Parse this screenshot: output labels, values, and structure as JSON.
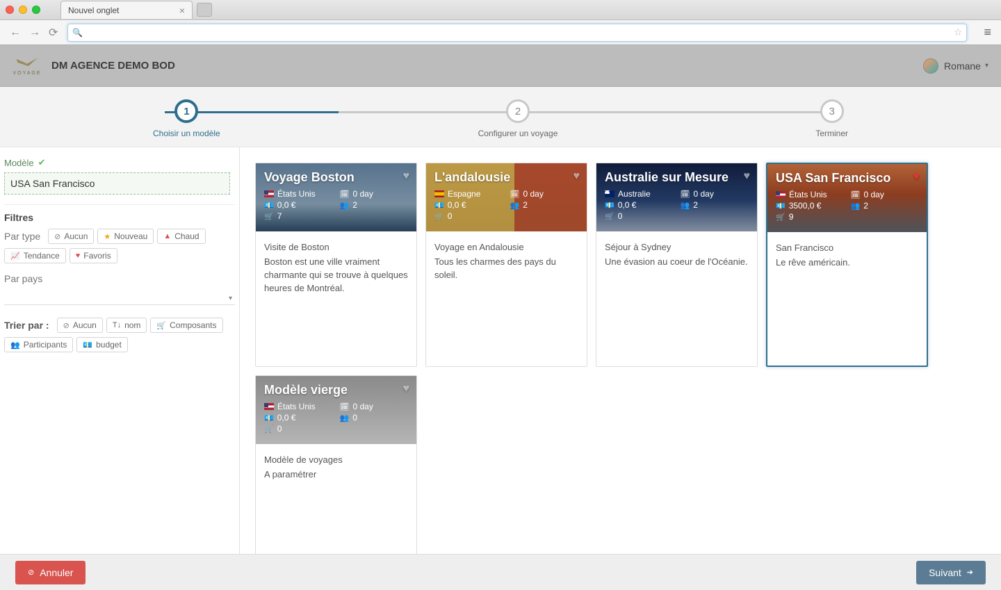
{
  "browser": {
    "tab_title": "Nouvel onglet",
    "url": ""
  },
  "header": {
    "agency": "DM AGENCE DEMO BOD",
    "logo_text": "VOYAGE",
    "user_name": "Romane"
  },
  "stepper": {
    "steps": [
      {
        "num": "1",
        "label": "Choisir un modèle"
      },
      {
        "num": "2",
        "label": "Configurer un voyage"
      },
      {
        "num": "3",
        "label": "Terminer"
      }
    ]
  },
  "sidebar": {
    "model_label": "Modèle",
    "model_value": "USA San Francisco",
    "filters_title": "Filtres",
    "type_label": "Par type",
    "type_chips": {
      "none": "Aucun",
      "new": "Nouveau",
      "hot": "Chaud",
      "trend": "Tendance",
      "fav": "Favoris"
    },
    "country_label": "Par pays",
    "sort_label": "Trier par :",
    "sort_chips": {
      "none": "Aucun",
      "name": "nom",
      "components": "Composants",
      "participants": "Participants",
      "budget": "budget"
    }
  },
  "cards": [
    {
      "title": "Voyage Boston",
      "country": "États Unis",
      "flag": "us",
      "days": "0 day",
      "price": "0,0 €",
      "people": "2",
      "cart": "7",
      "fav": false,
      "lead": "Visite de Boston",
      "desc": "Boston est une ville vraiment charmante qui se trouve à quelques heures de Montréal.",
      "bg": "ch-boston",
      "selected": false
    },
    {
      "title": "L'andalousie",
      "country": "Espagne",
      "flag": "es",
      "days": "0 day",
      "price": "0,0 €",
      "people": "2",
      "cart": "0",
      "fav": false,
      "lead": "Voyage en Andalousie",
      "desc": "Tous les charmes des pays du soleil.",
      "bg": "ch-andal",
      "selected": false
    },
    {
      "title": "Australie sur Mesure",
      "country": "Australie",
      "flag": "au",
      "days": "0 day",
      "price": "0,0 €",
      "people": "2",
      "cart": "0",
      "fav": false,
      "lead": "Séjour à Sydney",
      "desc": "Une évasion au coeur de l'Océanie.",
      "bg": "ch-austr",
      "selected": false
    },
    {
      "title": "USA San Francisco",
      "country": "États Unis",
      "flag": "us",
      "days": "0 day",
      "price": "3500,0 €",
      "people": "2",
      "cart": "9",
      "fav": true,
      "lead": "San Francisco",
      "desc": "Le rêve américain.",
      "bg": "ch-usa",
      "selected": true
    },
    {
      "title": "Modèle vierge",
      "country": "États Unis",
      "flag": "us",
      "days": "0 day",
      "price": "0,0 €",
      "people": "0",
      "cart": "0",
      "fav": false,
      "lead": "Modèle de voyages",
      "desc": "A paramétrer",
      "bg": "ch-blank",
      "selected": false
    }
  ],
  "footer": {
    "cancel": "Annuler",
    "next": "Suivant"
  }
}
